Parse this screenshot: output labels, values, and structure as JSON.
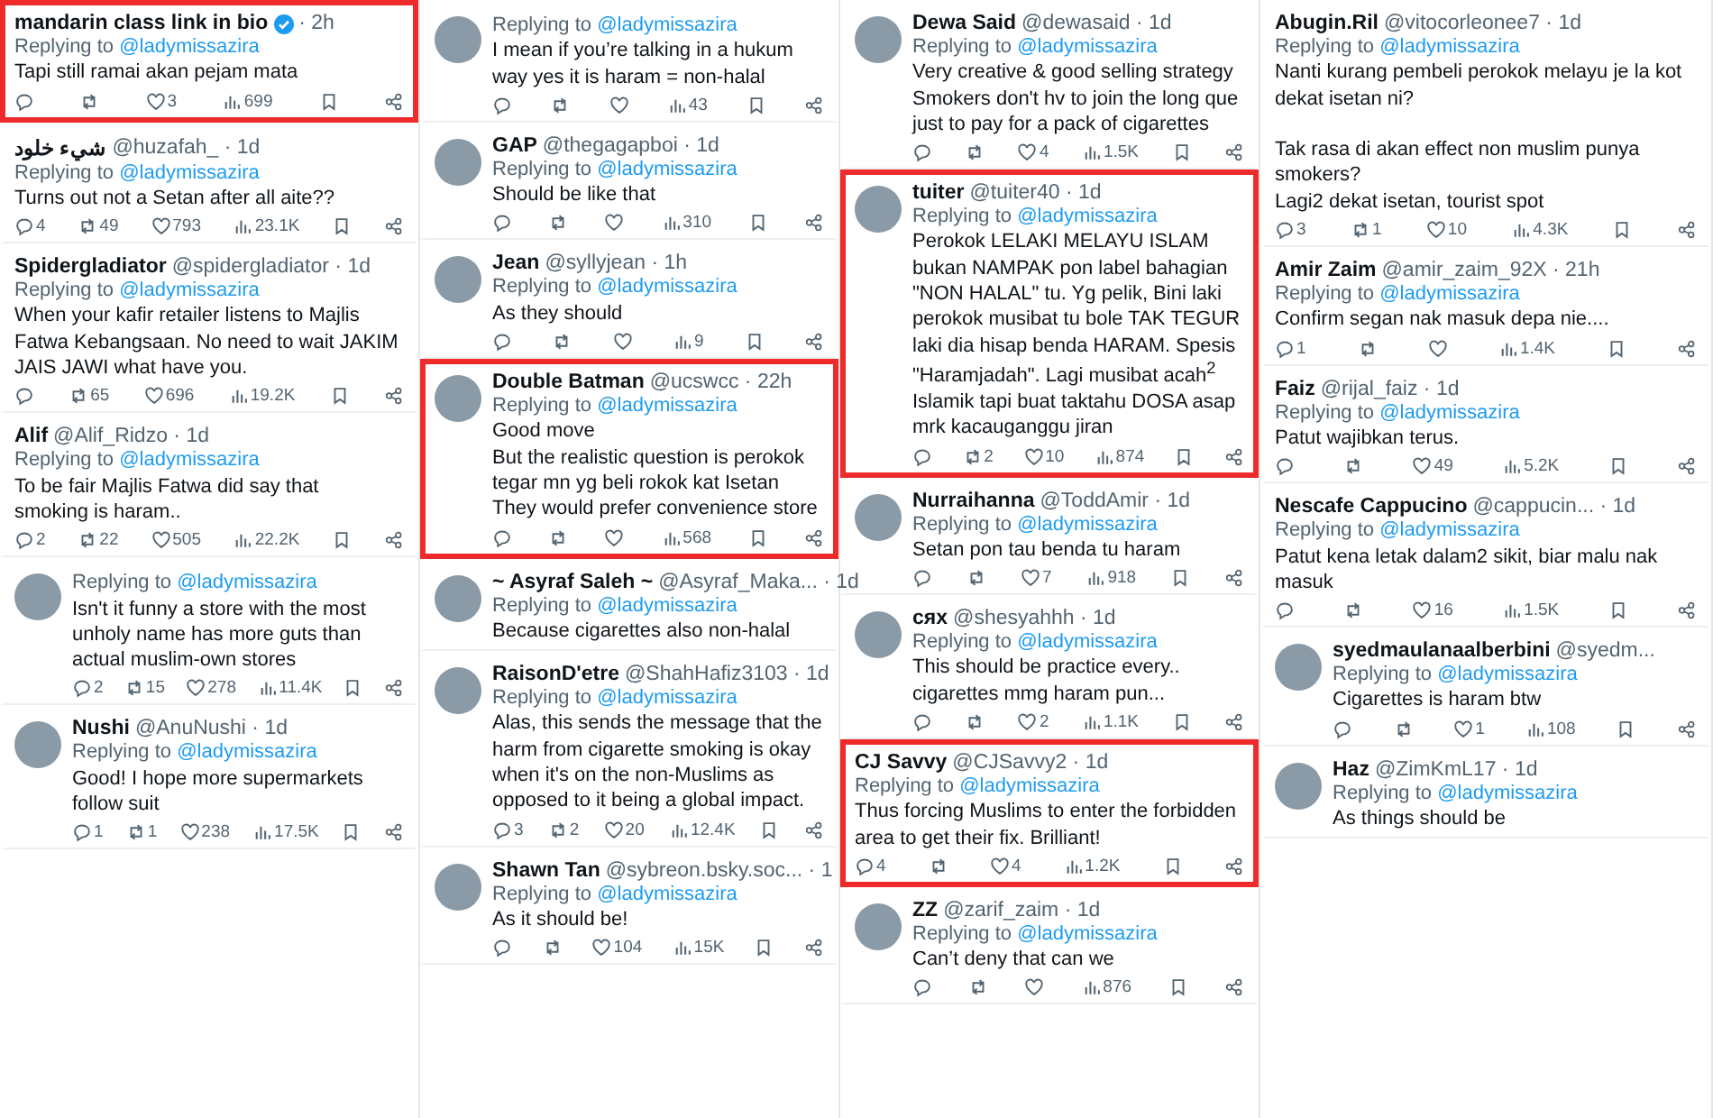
{
  "columns": [
    {
      "tweets": [
        {
          "name": "mandarin class link in bio",
          "verified": true,
          "avatar": false,
          "highlighted": true,
          "meta": "· 2h",
          "reply_label": "Replying to",
          "reply_to": "@ladymissazira",
          "text": "Tapi still ramai akan pejam mata",
          "stats": {
            "likes": "3",
            "views": "699"
          }
        },
        {
          "name": "شيء خلود",
          "verified": false,
          "avatar": false,
          "highlighted": false,
          "meta": "@huzafah_ · 1d",
          "reply_label": "Replying to",
          "reply_to": "@ladymissazira",
          "text": "Turns out not a Setan after all aite??",
          "stats": {
            "replies": "4",
            "reposts": "49",
            "likes": "793",
            "views": "23.1K"
          }
        },
        {
          "name": "Spidergladiator",
          "verified": false,
          "avatar": false,
          "highlighted": false,
          "meta": "@spidergladiator · 1d",
          "reply_label": "Replying to",
          "reply_to": "@ladymissazira",
          "text": "When your kafir retailer listens to Majlis Fatwa Kebangsaan. No need to wait JAKIM JAIS JAWI what have you.",
          "stats": {
            "reposts": "65",
            "likes": "696",
            "views": "19.2K"
          }
        },
        {
          "name": "Alif",
          "verified": false,
          "avatar": false,
          "highlighted": false,
          "meta": "@Alif_Ridzo · 1d",
          "reply_label": "Replying to",
          "reply_to": "@ladymissazira",
          "text": "To be fair Majlis Fatwa did say that\nsmoking is haram..",
          "stats": {
            "replies": "2",
            "reposts": "22",
            "likes": "505",
            "views": "22.2K"
          }
        },
        {
          "avatar": true,
          "highlighted": false,
          "reply_label": "Replying to",
          "reply_to": "@ladymissazira",
          "text": "Isn't it funny a store with the most unholy name has more guts than actual muslim-own stores",
          "stats": {
            "replies": "2",
            "reposts": "15",
            "likes": "278",
            "views": "11.4K"
          }
        },
        {
          "name": "Nushi",
          "verified": false,
          "avatar": true,
          "highlighted": false,
          "meta": "@AnuNushi · 1d",
          "reply_label": "Replying to",
          "reply_to": "@ladymissazira",
          "text": "Good! I hope more supermarkets follow suit",
          "stats": {
            "replies": "1",
            "reposts": "1",
            "likes": "238",
            "views": "17.5K"
          }
        }
      ]
    },
    {
      "tweets": [
        {
          "avatar": true,
          "highlighted": false,
          "reply_label": "Replying to",
          "reply_to": "@ladymissazira",
          "text": "I mean if you’re talking in a hukum way yes it is haram = non-halal",
          "stats": {
            "views": "43"
          }
        },
        {
          "name": "GAP",
          "verified": false,
          "avatar": true,
          "highlighted": false,
          "meta": "@thegagapboi · 1d",
          "reply_label": "Replying to",
          "reply_to": "@ladymissazira",
          "text": "Should be like that",
          "stats": {
            "views": "310"
          }
        },
        {
          "name": "Jean",
          "verified": false,
          "avatar": true,
          "highlighted": false,
          "meta": "@syllyjean · 1h",
          "reply_label": "Replying to",
          "reply_to": "@ladymissazira",
          "text": "As they should",
          "stats": {
            "views": "9"
          }
        },
        {
          "name": "Double Batman",
          "verified": false,
          "avatar": true,
          "highlighted": true,
          "meta": "@ucswcc · 22h",
          "reply_label": "Replying to",
          "reply_to": "@ladymissazira",
          "text": "Good move\nBut the realistic question is perokok tegar mn yg beli rokok kat Isetan\nThey would prefer convenience store",
          "stats": {
            "views": "568"
          }
        },
        {
          "name": "~ Asyraf Saleh ~",
          "verified": false,
          "avatar": true,
          "highlighted": false,
          "meta": "@Asyraf_Maka... · 1d",
          "reply_label": "Replying to",
          "reply_to": "@ladymissazira",
          "text": "Because cigarettes also non-halal"
        },
        {
          "name": "RaisonD'etre",
          "verified": false,
          "avatar": true,
          "highlighted": false,
          "meta": "@ShahHafiz3103 · 1d",
          "reply_label": "Replying to",
          "reply_to": "@ladymissazira",
          "text": "Alas, this sends the message that the harm from cigarette smoking is okay when it's on the non-Muslims as opposed to it being a global impact.",
          "stats": {
            "replies": "3",
            "reposts": "2",
            "likes": "20",
            "views": "12.4K"
          }
        },
        {
          "name": "Shawn Tan",
          "verified": false,
          "avatar": true,
          "highlighted": false,
          "meta": "@sybreon.bsky.soc... · 1",
          "reply_label": "Replying to",
          "reply_to": "@ladymissazira",
          "text": "As it should be!",
          "stats": {
            "likes": "104",
            "views": "15K"
          }
        }
      ]
    },
    {
      "tweets": [
        {
          "name": "Dewa Said",
          "verified": false,
          "avatar": true,
          "highlighted": false,
          "meta": "@dewasaid · 1d",
          "reply_label": "Replying to",
          "reply_to": "@ladymissazira",
          "text": "Very creative & good selling strategy\nSmokers don't hv to join the long que just to pay for a pack of cigarettes",
          "stats": {
            "likes": "4",
            "views": "1.5K"
          }
        },
        {
          "name": "tuiter",
          "verified": false,
          "avatar": true,
          "highlighted": true,
          "meta": "@tuiter40 · 1d",
          "reply_label": "Replying to",
          "reply_to": "@ladymissazira",
          "text": "Perokok LELAKI MELAYU ISLAM bukan NAMPAK pon label bahagian \"NON HALAL\" tu. Yg pelik, Bini laki perokok musibat tu bole TAK TEGUR laki dia hisap benda HARAM. Spesis \"Haramjadah\". Lagi musibat acah$^{2}$ Islamik tapi buat taktahu DOSA asap mrk kacauganggu jiran",
          "stats": {
            "reposts": "2",
            "likes": "10",
            "views": "874"
          }
        },
        {
          "name": "Nurraihanna",
          "verified": false,
          "avatar": true,
          "highlighted": false,
          "meta": "@ToddAmir · 1d",
          "reply_label": "Replying to",
          "reply_to": "@ladymissazira",
          "text": "Setan pon tau benda tu haram",
          "stats": {
            "likes": "7",
            "views": "918"
          }
        },
        {
          "name": "cяx",
          "verified": false,
          "avatar": true,
          "highlighted": false,
          "meta": "@shesyahhh · 1d",
          "reply_label": "Replying to",
          "reply_to": "@ladymissazira",
          "text": "This should be practice every.. cigarettes mmg haram pun...",
          "stats": {
            "likes": "2",
            "views": "1.1K"
          }
        },
        {
          "name": "CJ Savvy",
          "verified": false,
          "avatar": false,
          "highlighted": true,
          "meta": "@CJSavvy2 · 1d",
          "reply_label": "Replying to",
          "reply_to": "@ladymissazira",
          "text": "Thus forcing Muslims to enter the forbidden area to get their fix. Brilliant!",
          "stats": {
            "replies": "4",
            "likes": "4",
            "views": "1.2K"
          }
        },
        {
          "name": "ZZ",
          "verified": false,
          "avatar": true,
          "highlighted": false,
          "meta": "@zarif_zaim · 1d",
          "reply_label": "Replying to",
          "reply_to": "@ladymissazira",
          "text": "Can’t deny that can we",
          "stats": {
            "views": "876"
          }
        }
      ]
    },
    {
      "tweets": [
        {
          "name": "Abugin.Ril",
          "verified": false,
          "avatar": false,
          "highlighted": false,
          "meta": "@vitocorleonee7 · 1d",
          "reply_label": "Replying to",
          "reply_to": "@ladymissazira",
          "text": "Nanti kurang pembeli perokok melayu je la kot dekat isetan ni?\n\nTak rasa di akan effect non muslim punya smokers?\nLagi2 dekat isetan, tourist spot",
          "stats": {
            "replies": "3",
            "reposts": "1",
            "likes": "10",
            "views": "4.3K"
          }
        },
        {
          "name": "Amir Zaim",
          "verified": false,
          "avatar": false,
          "highlighted": false,
          "meta": "@amir_zaim_92X · 21h",
          "reply_label": "Replying to",
          "reply_to": "@ladymissazira",
          "text": "Confirm segan nak masuk depa nie....",
          "stats": {
            "replies": "1",
            "views": "1.4K"
          }
        },
        {
          "name": "Faiz",
          "verified": false,
          "avatar": false,
          "highlighted": false,
          "meta": "@rijal_faiz · 1d",
          "reply_label": "Replying to",
          "reply_to": "@ladymissazira",
          "text": "Patut wajibkan terus.",
          "stats": {
            "likes": "49",
            "views": "5.2K"
          }
        },
        {
          "name": "Nescafe Cappucino",
          "verified": false,
          "avatar": false,
          "highlighted": false,
          "meta": "@cappucin... · 1d",
          "reply_label": "Replying to",
          "reply_to": "@ladymissazira",
          "text": "Patut kena letak dalam2 sikit, biar malu nak masuk",
          "stats": {
            "likes": "16",
            "views": "1.5K"
          }
        },
        {
          "name": "syedmaulanaalberbini",
          "verified": false,
          "avatar": true,
          "highlighted": false,
          "meta": "@syedm...",
          "reply_label": "Replying to",
          "reply_to": "@ladymissazira",
          "text": "Cigarettes is haram btw",
          "stats": {
            "likes": "1",
            "views": "108"
          }
        },
        {
          "name": "Haz",
          "verified": false,
          "avatar": true,
          "highlighted": false,
          "meta": "@ZimKmL17 · 1d",
          "reply_label": "Replying to",
          "reply_to": "@ladymissazira",
          "text": "As things should be"
        }
      ]
    }
  ]
}
